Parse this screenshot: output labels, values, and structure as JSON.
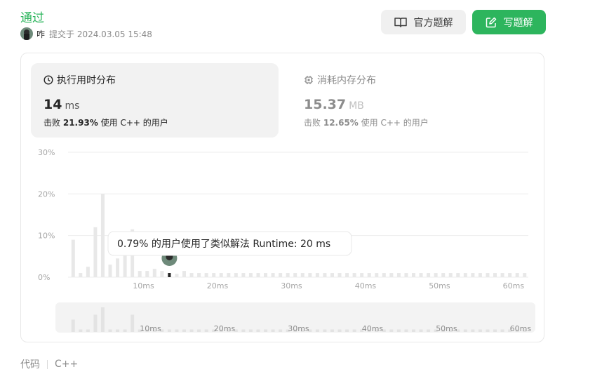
{
  "submission": {
    "status": "通过",
    "username": "咋",
    "submitted_text": "提交于 2024.03.05 15:48"
  },
  "buttons": {
    "official": "官方题解",
    "write": "写题解"
  },
  "tabs": {
    "runtime": {
      "title": "执行用时分布",
      "value": "14",
      "unit": "ms",
      "beats_prefix": "击败",
      "beats_pct": "21.93%",
      "beats_suffix": "使用 C++ 的用户"
    },
    "memory": {
      "title": "消耗内存分布",
      "value": "15.37",
      "unit": "MB",
      "beats_prefix": "击败",
      "beats_pct": "12.65%",
      "beats_suffix": "使用 C++ 的用户"
    }
  },
  "tooltip": "0.79% 的用户使用了类似解法 Runtime: 20 ms",
  "footer": {
    "label": "代码",
    "language": "C++"
  },
  "colors": {
    "accent": "#2db55d",
    "bar": "#e8e8e8",
    "highlight": "#262626"
  },
  "icons": {
    "official": "book-icon",
    "write": "edit-icon",
    "runtime": "clock-icon",
    "memory": "chip-icon"
  },
  "chart_data": {
    "type": "bar",
    "y_ticks": [
      "30%",
      "20%",
      "10%",
      "0%"
    ],
    "x_ticks": [
      "10ms",
      "20ms",
      "30ms",
      "40ms",
      "50ms",
      "60ms"
    ],
    "ylim": [
      0,
      30
    ],
    "xlim": [
      0,
      62
    ],
    "bar_step_ms": 1,
    "values": [
      9,
      1,
      2.5,
      12,
      20,
      3,
      4.5,
      7,
      11.5,
      1.5,
      1.5,
      2,
      1.5,
      1,
      0.8,
      1.5,
      1,
      1,
      1,
      1,
      1,
      1,
      1,
      1,
      1,
      1,
      1,
      1,
      1,
      1,
      1,
      1,
      1,
      1,
      1,
      1,
      1,
      1,
      1,
      1,
      1,
      1,
      1,
      1,
      1,
      1,
      1,
      1,
      1,
      1,
      1,
      1,
      1,
      1,
      1,
      1,
      1,
      1,
      1,
      1,
      1,
      1
    ],
    "user_runtime_ms": 14,
    "overview_values": [
      5,
      1,
      1,
      7,
      10,
      1,
      1,
      1,
      7,
      1,
      1,
      1,
      1,
      1,
      1,
      1,
      1,
      1,
      1,
      1,
      1,
      1,
      1,
      1,
      1,
      1,
      1,
      1,
      1,
      1,
      1,
      1,
      1,
      1,
      1,
      1,
      1,
      1,
      1,
      1,
      1,
      1,
      1,
      1,
      1,
      1,
      1,
      1,
      1,
      1,
      1,
      1,
      1,
      1,
      1,
      1,
      1,
      1,
      1,
      1,
      1,
      1
    ]
  }
}
